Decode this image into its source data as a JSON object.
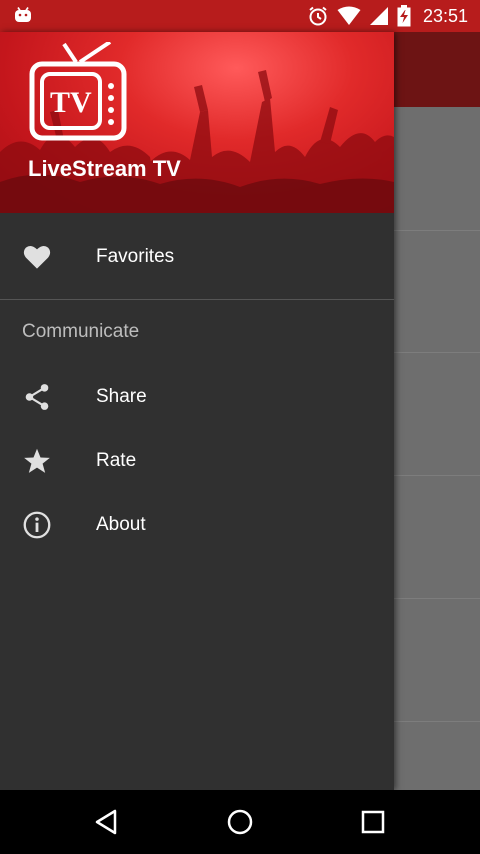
{
  "status_bar": {
    "time": "23:51",
    "icons": [
      "android-notification-icon",
      "alarm-icon",
      "wifi-icon",
      "cell-signal-icon",
      "battery-charging-icon"
    ]
  },
  "drawer": {
    "app_name": "LiveStream TV",
    "logo_text": "TV",
    "items": [
      {
        "label": "Favorites",
        "icon": "heart-icon"
      }
    ],
    "section_header": "Communicate",
    "section_items": [
      {
        "label": "Share",
        "icon": "share-icon"
      },
      {
        "label": "Rate",
        "icon": "star-icon"
      },
      {
        "label": "About",
        "icon": "info-icon"
      }
    ]
  },
  "nav_bar": {
    "buttons": [
      "back-icon",
      "home-icon",
      "recents-icon"
    ]
  },
  "colors": {
    "status_bar": "#b71c1c",
    "header_red": "#d32027",
    "drawer_bg": "#303030",
    "nav_bar": "#000000"
  }
}
